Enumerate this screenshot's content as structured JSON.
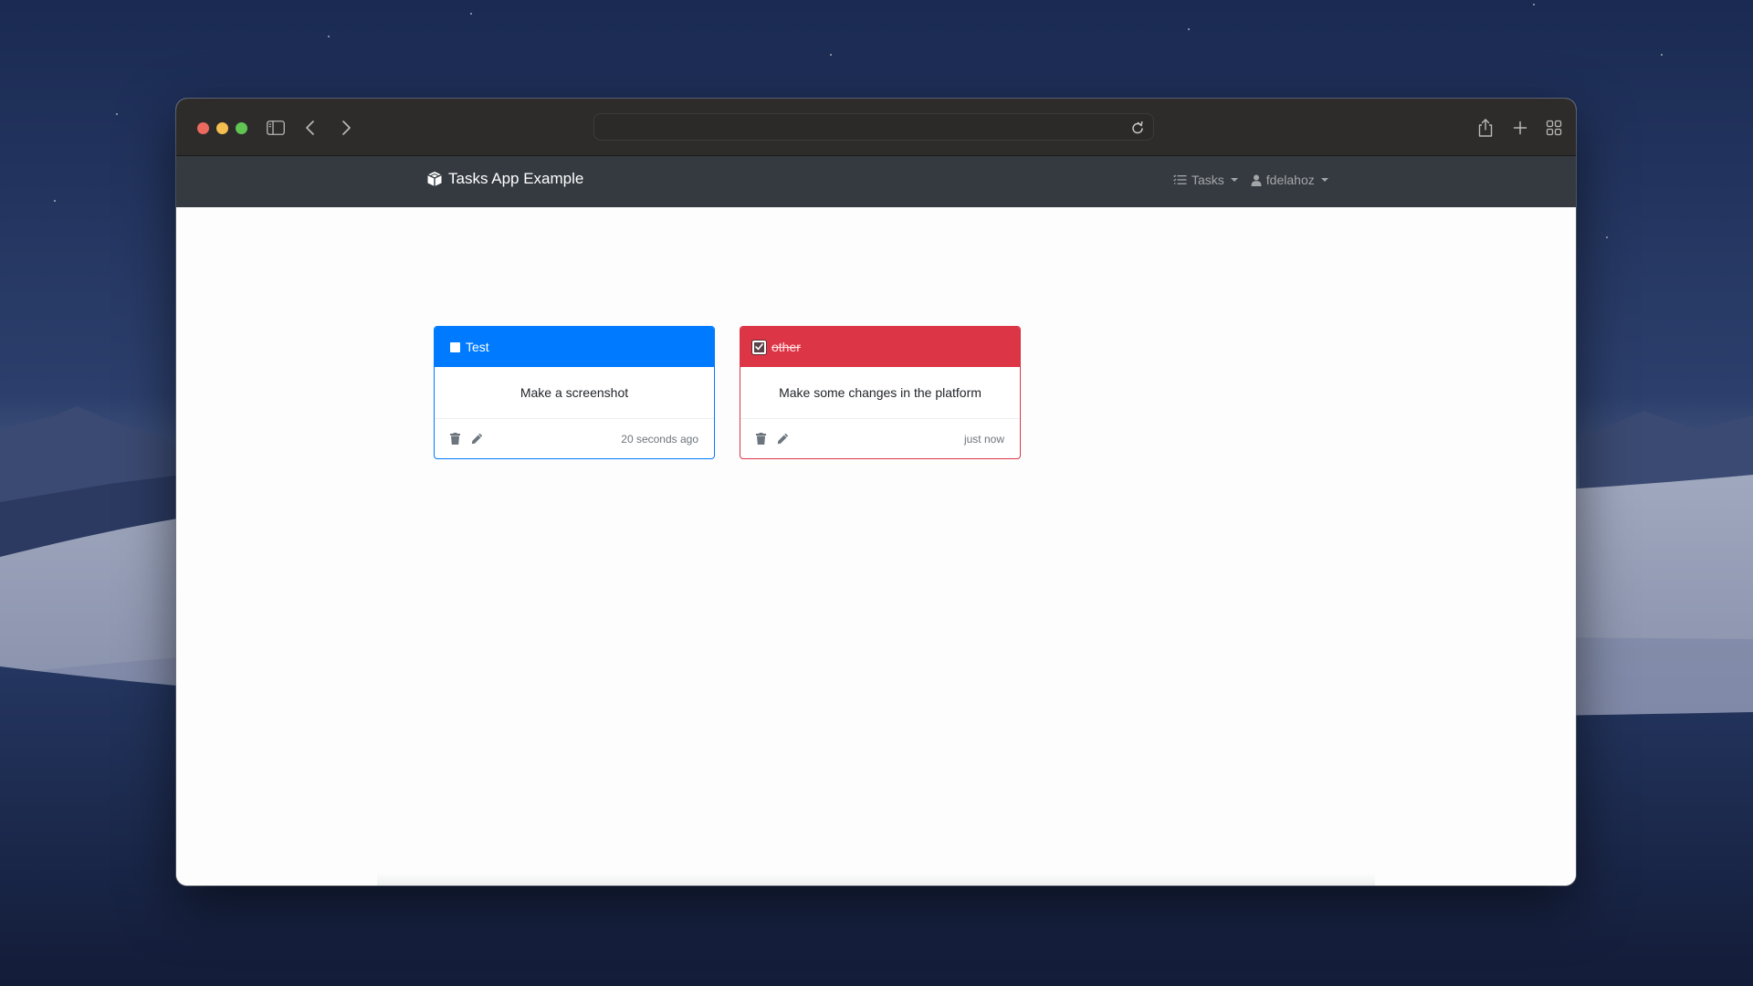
{
  "browser": {
    "url": "",
    "url_placeholder": "",
    "toolbar_icons": [
      "sidebar-icon",
      "back-icon",
      "forward-icon",
      "reload-icon",
      "share-icon",
      "new-tab-icon",
      "tab-overview-icon"
    ]
  },
  "navbar": {
    "brand_icon": "cube-icon",
    "brand": "Tasks App Example",
    "menus": [
      {
        "icon": "task-list-icon",
        "label": "Tasks"
      },
      {
        "icon": "user-icon",
        "label": "fdelahoz"
      }
    ]
  },
  "tasks": [
    {
      "title": "Test",
      "description": "Make a screenshot",
      "completed": false,
      "color": "#007bff",
      "timestamp": "20 seconds ago"
    },
    {
      "title": "other",
      "description": "Make some changes in the platform",
      "completed": true,
      "color": "#dc3545",
      "timestamp": "just now"
    }
  ],
  "colors": {
    "primary": "#007bff",
    "danger": "#dc3545",
    "navbar": "#343a40",
    "titlebar": "#2e2c2b"
  }
}
